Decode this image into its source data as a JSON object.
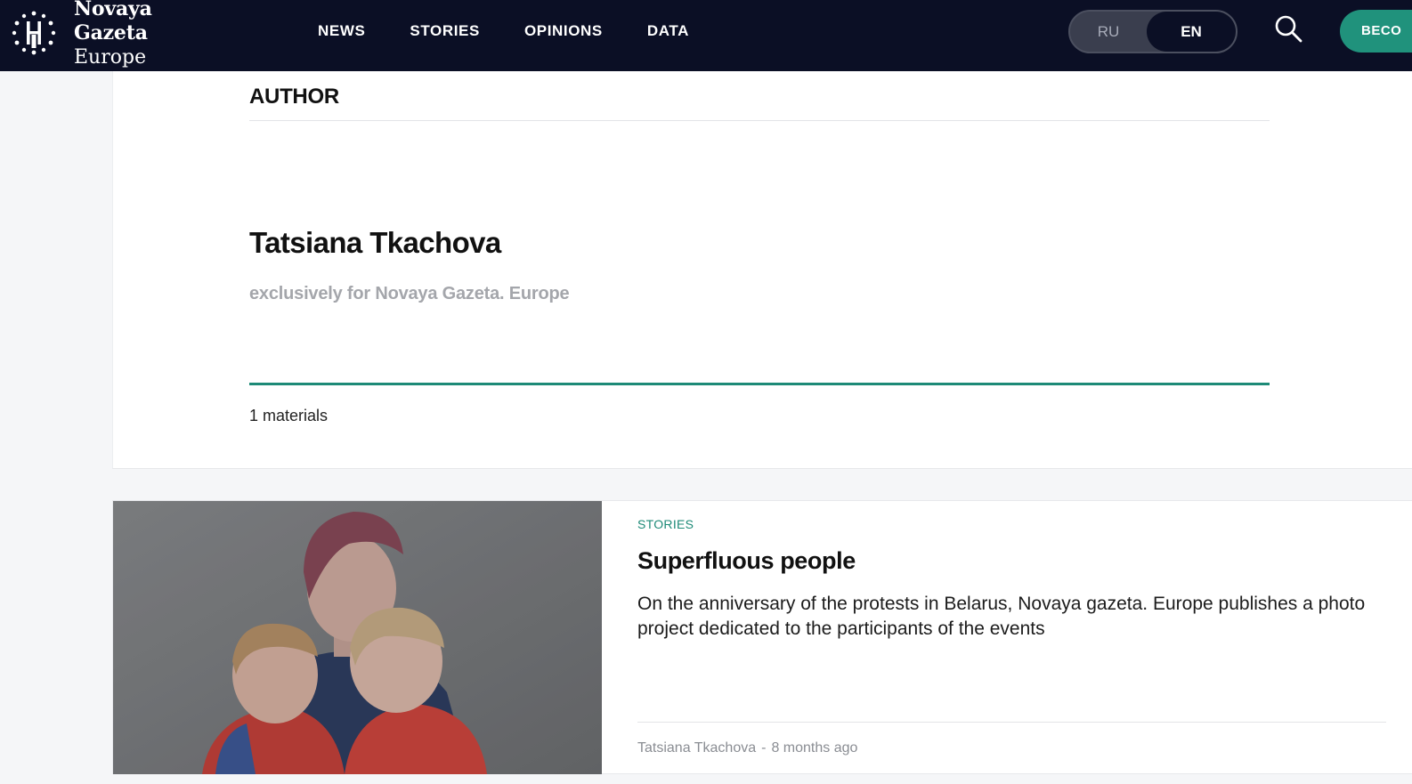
{
  "header": {
    "logo_line1": "Novaya Gazeta",
    "logo_line2": "Europe",
    "nav": [
      {
        "label": "NEWS"
      },
      {
        "label": "STORIES"
      },
      {
        "label": "OPINIONS"
      },
      {
        "label": "DATA"
      }
    ],
    "lang": {
      "ru": "RU",
      "en": "EN",
      "active": "EN"
    },
    "search_icon": "search-icon",
    "become_label": "BECO"
  },
  "author": {
    "section_heading": "AUTHOR",
    "name": "Tatsiana Tkachova",
    "description": "exclusively for Novaya Gazeta. Europe",
    "materials": "1 materials"
  },
  "articles": [
    {
      "rubric": "STORIES",
      "title": "Superfluous people",
      "lead": "On the anniversary of the protests in Belarus, Novaya gazeta. Europe publishes a photo project dedicated to the participants of the events",
      "author": "Tatsiana Tkachova",
      "separator": "-",
      "time": "8 months ago"
    }
  ],
  "colors": {
    "header_bg": "#0b0f25",
    "accent": "#1d8a77",
    "button": "#20927c",
    "muted_text": "#a4a6ab"
  }
}
